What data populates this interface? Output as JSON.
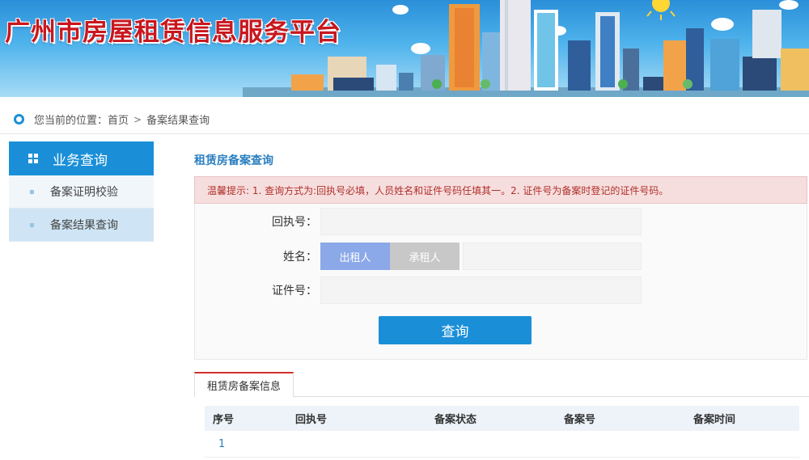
{
  "banner": {
    "title": "广州市房屋租赁信息服务平台"
  },
  "breadcrumb": {
    "prefix": "您当前的位置：首页",
    "separator": ">",
    "current": "备案结果查询"
  },
  "sidebar": {
    "header": "业务查询",
    "items": [
      {
        "label": "备案证明校验"
      },
      {
        "label": "备案结果查询"
      }
    ]
  },
  "main": {
    "title": "租赁房备案查询",
    "notice": "温馨提示: 1. 查询方式为:回执号必填，人员姓名和证件号码任填其一。2. 证件号为备案时登记的证件号码。",
    "form": {
      "receipt_label": "回执号：",
      "receipt_value": "",
      "name_label": "姓名：",
      "toggle_landlord": "出租人",
      "toggle_tenant": "承租人",
      "name_value": "",
      "id_label": "证件号：",
      "id_value": "",
      "query_button": "查询"
    },
    "tab": "租赁房备案信息",
    "table": {
      "headers": [
        "序号",
        "回执号",
        "备案状态",
        "备案号",
        "备案时间"
      ],
      "rows": [
        [
          "1",
          "",
          "",
          "",
          ""
        ]
      ]
    }
  },
  "colors": {
    "accent": "#1a8fd8",
    "title_red": "#c8171e",
    "notice_bg": "#f6dede"
  }
}
